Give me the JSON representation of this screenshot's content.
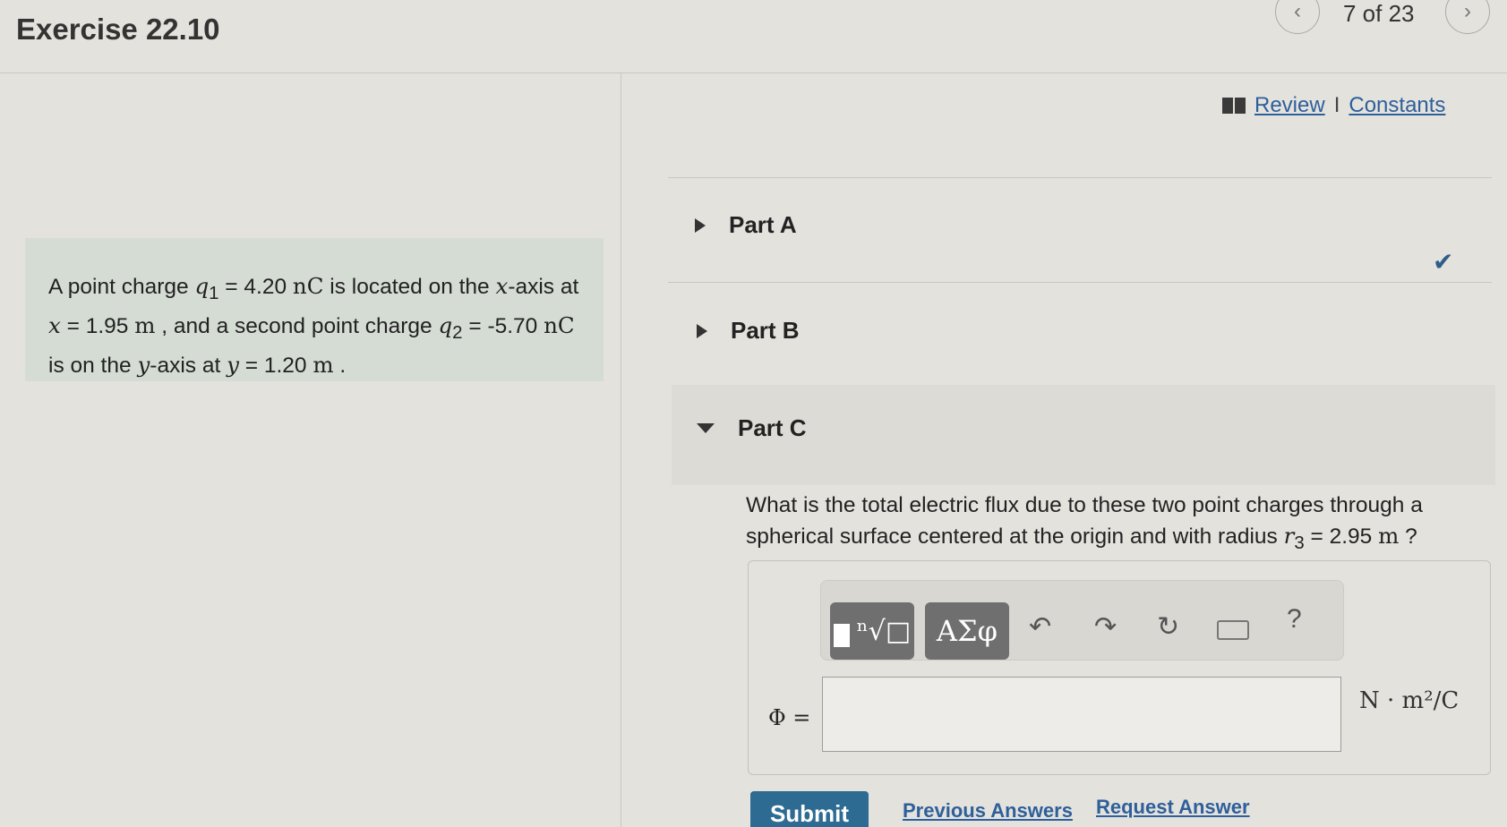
{
  "header": {
    "title": "Exercise 22.10",
    "page_count": "7 of 23",
    "prev_icon": "‹",
    "next_icon": "›"
  },
  "problem": {
    "t1": "A point charge ",
    "q1": "q",
    "q1_sub": "1",
    "t2": " = 4.20 ",
    "unit_nC": "nC",
    "t3": " is located on the ",
    "x_var": "x",
    "t4": "-axis at ",
    "x_var2": "x",
    "t5": " = 1.95 ",
    "unit_m": "m",
    "t6": " , and a second point charge ",
    "q2": "q",
    "q2_sub": "2",
    "t7": " = -5.70 ",
    "unit_nC2": "nC",
    "t8": " is on the ",
    "y_var": "y",
    "t9": "-axis at ",
    "y_var2": "y",
    "t10": " = 1.20 ",
    "unit_m2": "m",
    "t11": " ."
  },
  "links": {
    "review": "Review",
    "separator": "I",
    "constants": "Constants"
  },
  "parts": {
    "a": "Part A",
    "b": "Part B",
    "c": "Part C",
    "a_status": "✔"
  },
  "question": {
    "t1": "What is the total electric flux due to these two point charges through a spherical surface centered at the origin and with radius ",
    "r": "r",
    "r_sub": "3",
    "t2": " = 2.95 ",
    "unit": "m",
    "t3": " ?"
  },
  "toolbar": {
    "templates_symbol": "ⁿ√□",
    "greek_label": "ΑΣφ",
    "undo_icon": "↶",
    "redo_icon": "↷",
    "reset_icon": "↻",
    "help_label": "?"
  },
  "answer": {
    "label": "Φ =",
    "value": "",
    "units": "N · m²/C"
  },
  "actions": {
    "submit": "Submit",
    "previous_answers": "Previous Answers",
    "request_answer": "Request Answer"
  }
}
